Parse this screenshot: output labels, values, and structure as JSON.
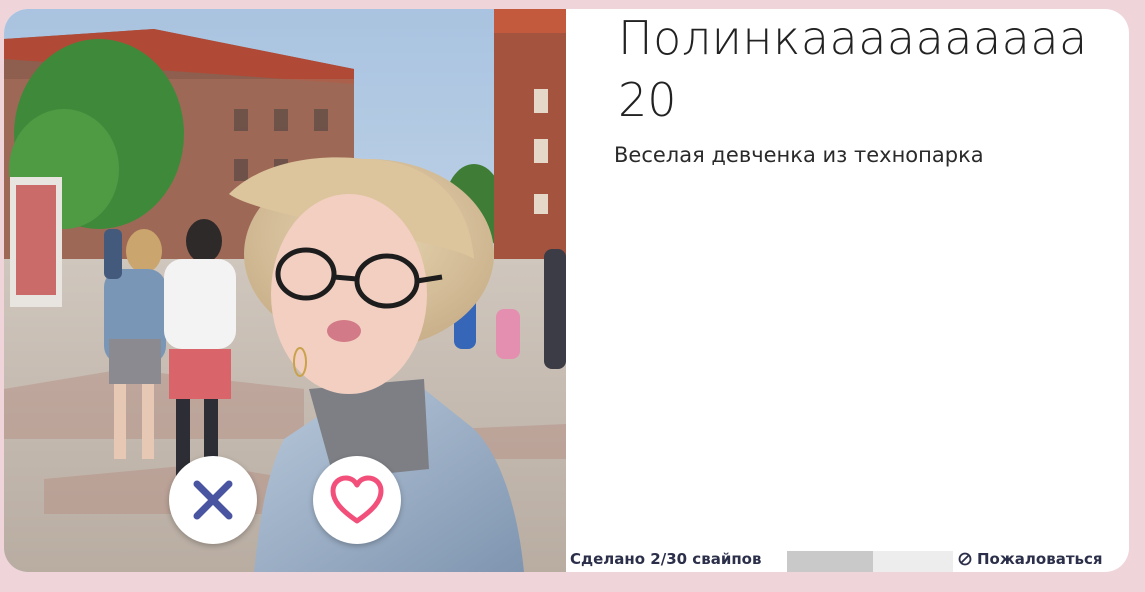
{
  "profile": {
    "name": "Полинкаааааааааа",
    "age": "20",
    "bio": "Веселая девченка из технопарка"
  },
  "actions": {
    "dislike_icon": "close-icon",
    "like_icon": "heart-icon"
  },
  "footer": {
    "swipes_text": "Сделано 2/30 свайпов",
    "swipes_done": 2,
    "swipes_total": 30,
    "progress_fraction": 0.52,
    "report_label": "Пожаловаться",
    "report_icon": "block-icon"
  },
  "colors": {
    "background": "#efd4da",
    "dislike": "#4a55a2",
    "like": "#f2507b",
    "text_dark": "#2b2f4a"
  }
}
